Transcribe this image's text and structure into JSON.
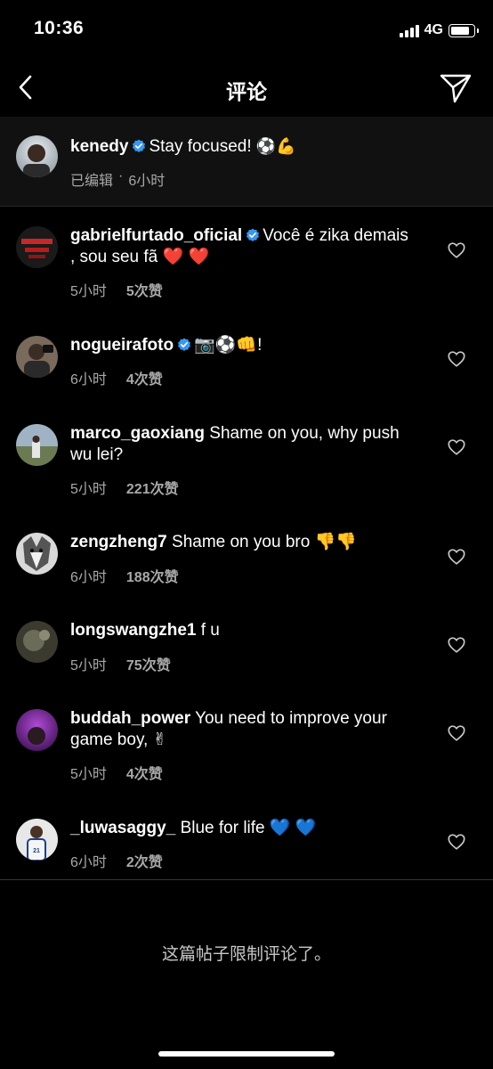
{
  "status_bar": {
    "time": "10:36",
    "network": "4G",
    "signal_bars": 4,
    "battery_level": 0.85
  },
  "nav": {
    "title": "评论",
    "back_icon": "chevron-left-icon",
    "share_icon": "paper-plane-icon"
  },
  "caption": {
    "username": "kenedy",
    "verified": true,
    "text": "Stay focused!",
    "emoji": "⚽💪",
    "edited_label": "已编辑",
    "separator": "·",
    "time": "6小时"
  },
  "comments": [
    {
      "username": "gabrielfurtado_oficial",
      "verified": true,
      "text": "Você é zika demais , sou seu fã ❤️ ❤️",
      "time": "5小时",
      "likes": "5次赞"
    },
    {
      "username": "nogueirafoto",
      "verified": true,
      "text": "📷⚽👊!",
      "time": "6小时",
      "likes": "4次赞"
    },
    {
      "username": "marco_gaoxiang",
      "verified": false,
      "text": "Shame on you,  why push wu lei?",
      "time": "5小时",
      "likes": "221次赞"
    },
    {
      "username": "zengzheng7",
      "verified": false,
      "text": "Shame on you bro 👎👎",
      "time": "6小时",
      "likes": "188次赞"
    },
    {
      "username": "longswangzhe1",
      "verified": false,
      "text": "f u",
      "time": "5小时",
      "likes": "75次赞"
    },
    {
      "username": "buddah_power",
      "verified": false,
      "text": "You need to improve your game boy, ✌",
      "time": "5小时",
      "likes": "4次赞"
    },
    {
      "username": "_luwasaggy_",
      "verified": false,
      "text": "Blue for life 💙 💙",
      "time": "6小时",
      "likes": "2次赞"
    }
  ],
  "footer": {
    "note": "这篇帖子限制评论了。"
  },
  "colors": {
    "background": "#000000",
    "caption_bg": "#111111",
    "meta_text": "#a8a8a8",
    "verified_blue": "#3897f0"
  }
}
